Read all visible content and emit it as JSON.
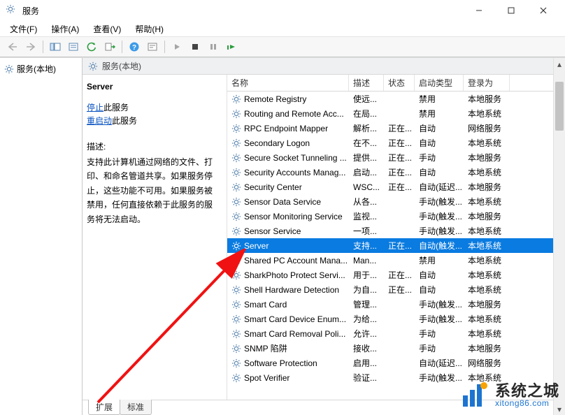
{
  "window_title": "服务",
  "menu": {
    "file": "文件(F)",
    "action": "操作(A)",
    "view": "查看(V)",
    "help": "帮助(H)"
  },
  "tree_label": "服务(本地)",
  "inner_header": "服务(本地)",
  "details": {
    "title": "Server",
    "stop_link": "停止",
    "stop_suffix": "此服务",
    "restart_link": "重启动",
    "restart_suffix": "此服务",
    "desc_label": "描述:",
    "desc_text": "支持此计算机通过网络的文件、打印、和命名管道共享。如果服务停止，这些功能不可用。如果服务被禁用，任何直接依赖于此服务的服务将无法启动。"
  },
  "columns": {
    "name": "名称",
    "desc": "描述",
    "state": "状态",
    "startup": "启动类型",
    "logon": "登录为"
  },
  "rows": [
    {
      "name": "Remote Registry",
      "desc": "使远...",
      "state": "",
      "startup": "禁用",
      "logon": "本地服务"
    },
    {
      "name": "Routing and Remote Acc...",
      "desc": "在局...",
      "state": "",
      "startup": "禁用",
      "logon": "本地系统"
    },
    {
      "name": "RPC Endpoint Mapper",
      "desc": "解析...",
      "state": "正在...",
      "startup": "自动",
      "logon": "网络服务"
    },
    {
      "name": "Secondary Logon",
      "desc": "在不...",
      "state": "正在...",
      "startup": "自动",
      "logon": "本地系统"
    },
    {
      "name": "Secure Socket Tunneling ...",
      "desc": "提供...",
      "state": "正在...",
      "startup": "手动",
      "logon": "本地服务"
    },
    {
      "name": "Security Accounts Manag...",
      "desc": "启动...",
      "state": "正在...",
      "startup": "自动",
      "logon": "本地系统"
    },
    {
      "name": "Security Center",
      "desc": "WSC...",
      "state": "正在...",
      "startup": "自动(延迟...",
      "logon": "本地服务"
    },
    {
      "name": "Sensor Data Service",
      "desc": "从各...",
      "state": "",
      "startup": "手动(触发...",
      "logon": "本地系统"
    },
    {
      "name": "Sensor Monitoring Service",
      "desc": "监视...",
      "state": "",
      "startup": "手动(触发...",
      "logon": "本地服务"
    },
    {
      "name": "Sensor Service",
      "desc": "一项...",
      "state": "",
      "startup": "手动(触发...",
      "logon": "本地系统"
    },
    {
      "name": "Server",
      "desc": "支持...",
      "state": "正在...",
      "startup": "自动(触发...",
      "logon": "本地系统",
      "selected": true
    },
    {
      "name": "Shared PC Account Mana...",
      "desc": "Man...",
      "state": "",
      "startup": "禁用",
      "logon": "本地系统"
    },
    {
      "name": "SharkPhoto Protect Servi...",
      "desc": "用于...",
      "state": "正在...",
      "startup": "自动",
      "logon": "本地系统"
    },
    {
      "name": "Shell Hardware Detection",
      "desc": "为自...",
      "state": "正在...",
      "startup": "自动",
      "logon": "本地系统"
    },
    {
      "name": "Smart Card",
      "desc": "管理...",
      "state": "",
      "startup": "手动(触发...",
      "logon": "本地服务"
    },
    {
      "name": "Smart Card Device Enum...",
      "desc": "为给...",
      "state": "",
      "startup": "手动(触发...",
      "logon": "本地系统"
    },
    {
      "name": "Smart Card Removal Poli...",
      "desc": "允许...",
      "state": "",
      "startup": "手动",
      "logon": "本地系统"
    },
    {
      "name": "SNMP 陷阱",
      "desc": "接收...",
      "state": "",
      "startup": "手动",
      "logon": "本地服务"
    },
    {
      "name": "Software Protection",
      "desc": "启用...",
      "state": "",
      "startup": "自动(延迟...",
      "logon": "网络服务"
    },
    {
      "name": "Spot Verifier",
      "desc": "验证...",
      "state": "",
      "startup": "手动(触发...",
      "logon": "本地系统"
    }
  ],
  "tabs": {
    "extended": "扩展",
    "standard": "标准"
  },
  "watermark": {
    "cn": "系统之城",
    "en": "xitong86.com"
  }
}
